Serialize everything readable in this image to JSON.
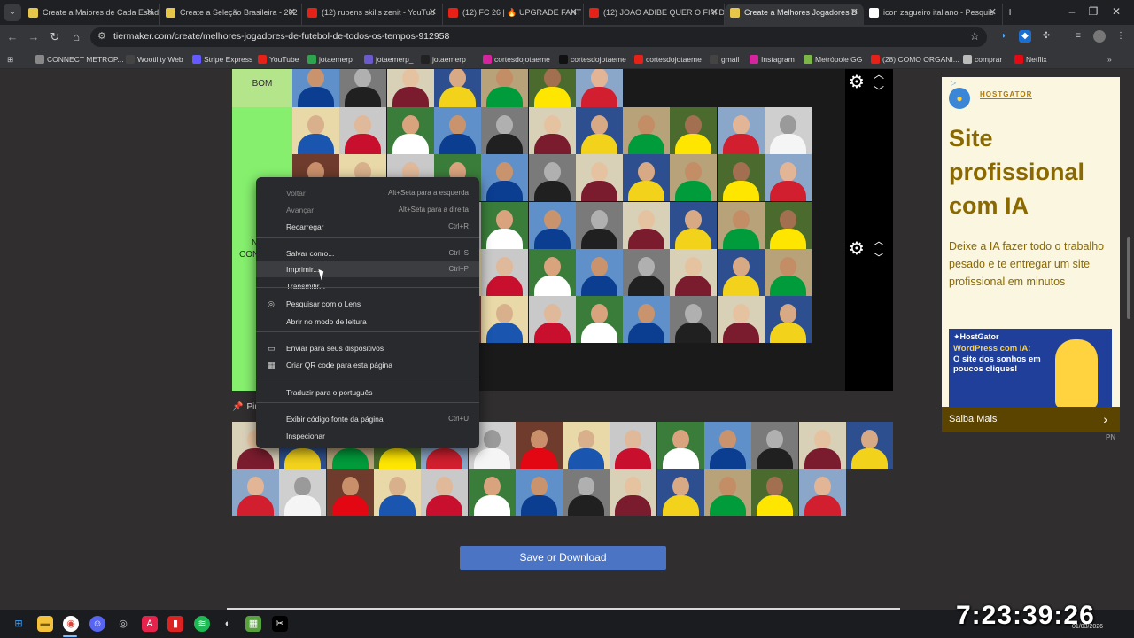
{
  "browser": {
    "tabs": [
      {
        "title": "Create a Maiores de Cada Estad",
        "favicon_color": "#e6c74a",
        "active": false
      },
      {
        "title": "Create a Seleção Brasileira - 202",
        "favicon_color": "#e6c74a",
        "active": false
      },
      {
        "title": "(12) rubens skills zenit - YouTub",
        "favicon_color": "#e62117",
        "active": false
      },
      {
        "title": "(12) FC 26 | 🔥 UPGRADE FANT",
        "favicon_color": "#e62117",
        "active": false
      },
      {
        "title": "(12) JOAO ADIBE QUER O FIM D",
        "favicon_color": "#e62117",
        "active": false
      },
      {
        "title": "Create a Melhores Jogadores D",
        "favicon_color": "#e6c74a",
        "active": true
      },
      {
        "title": "icon zagueiro italiano - Pesquis",
        "favicon_color": "#ffffff",
        "active": false
      }
    ],
    "url": "tiermaker.com/create/melhores-jogadores-de-futebol-de-todos-os-tempos-912958",
    "bookmarks": [
      {
        "label": "CONNECT METROP...",
        "color": "#888888"
      },
      {
        "label": "Wootility Web",
        "color": "#444444"
      },
      {
        "label": "Stripe Express",
        "color": "#635bff"
      },
      {
        "label": "YouTube",
        "color": "#e62117"
      },
      {
        "label": "jotaemerp",
        "color": "#2ea44f"
      },
      {
        "label": "jotaemerp_",
        "color": "#6a5acd"
      },
      {
        "label": "jotaemerp",
        "color": "#222222"
      },
      {
        "label": "cortesdojotaeme",
        "color": "#d6249f"
      },
      {
        "label": "cortesdojotaeme",
        "color": "#111111"
      },
      {
        "label": "cortesdojotaeme",
        "color": "#e62117"
      },
      {
        "label": "gmail",
        "color": "#444444"
      },
      {
        "label": "Instagram",
        "color": "#d6249f"
      },
      {
        "label": "Metrópole GG",
        "color": "#7ab648"
      },
      {
        "label": "(28) COMO ORGANI...",
        "color": "#e62117"
      },
      {
        "label": "comprar",
        "color": "#bbbbbb"
      },
      {
        "label": "Netflix",
        "color": "#e50914"
      }
    ]
  },
  "tiers": [
    {
      "label": "BOM",
      "color": "#b5e58a",
      "visible_label": "BOM"
    },
    {
      "label": "N\nCON",
      "color": "#86f06e",
      "visible_label_parts": [
        "N",
        "CON"
      ]
    }
  ],
  "pool": {
    "label": "Pin"
  },
  "save_button": "Save or Download",
  "ad": {
    "adchoice": "▷",
    "brand": "HOSTGATOR",
    "headline": "Site profissional com IA",
    "subtext": "Deixe a IA fazer todo o trabalho pesado e te entregar um site profissional em minutos",
    "banner_brand": "✦HostGator",
    "banner_line1": "WordPress com IA:",
    "banner_line2": "O site dos sonhos em poucos cliques!",
    "cta": "Saiba Mais",
    "mark": "PN"
  },
  "context_menu": [
    {
      "label": "Voltar",
      "shortcut": "Alt+Seta para a esquerda",
      "disabled": true,
      "icon": ""
    },
    {
      "label": "Avançar",
      "shortcut": "Alt+Seta para a direita",
      "disabled": true,
      "icon": ""
    },
    {
      "label": "Recarregar",
      "shortcut": "Ctrl+R",
      "disabled": false,
      "icon": ""
    },
    {
      "label": "Salvar como...",
      "shortcut": "Ctrl+S",
      "disabled": false,
      "icon": ""
    },
    {
      "label": "Imprimir...",
      "shortcut": "Ctrl+P",
      "disabled": false,
      "icon": "",
      "hover": true
    },
    {
      "label": "Transmitir...",
      "shortcut": "",
      "disabled": false,
      "icon": ""
    },
    {
      "label": "Pesquisar com o Lens",
      "shortcut": "",
      "disabled": false,
      "icon": "lens-icon"
    },
    {
      "label": "Abrir no modo de leitura",
      "shortcut": "",
      "disabled": false,
      "icon": ""
    },
    {
      "label": "Enviar para seus dispositivos",
      "shortcut": "",
      "disabled": false,
      "icon": "devices-icon"
    },
    {
      "label": "Criar QR code para esta página",
      "shortcut": "",
      "disabled": false,
      "icon": "qr-icon"
    },
    {
      "label": "Traduzir para o português",
      "shortcut": "",
      "disabled": false,
      "icon": ""
    },
    {
      "label": "Exibir código fonte da página",
      "shortcut": "Ctrl+U",
      "disabled": false,
      "icon": ""
    },
    {
      "label": "Inspecionar",
      "shortcut": "",
      "disabled": false,
      "icon": ""
    }
  ],
  "taskbar": {
    "clock": "7:23:39:26",
    "date": "01/03/2026"
  }
}
